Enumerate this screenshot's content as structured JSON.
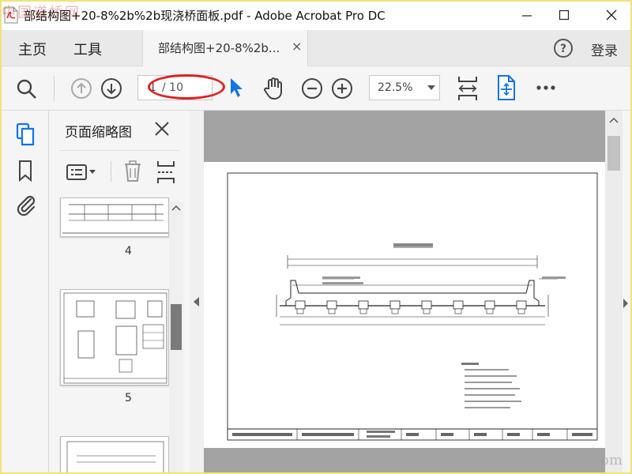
{
  "window": {
    "title": "部结构图+20-8%2b%2b现浇桥面板.pdf - Adobe Acrobat Pro DC",
    "watermark": "中国道桥网"
  },
  "nav": {
    "home": "主页",
    "tools": "工具",
    "doc_tab": "部结构图+20-8%2b...",
    "login": "登录"
  },
  "toolbar": {
    "current_page": "1",
    "total_pages": "/ 10",
    "zoom": "22.5%"
  },
  "thumbnails": {
    "title": "页面缩略图",
    "pages": [
      "4",
      "5"
    ]
  },
  "colors": {
    "accent": "#1473e6",
    "highlight": "#e02020"
  }
}
